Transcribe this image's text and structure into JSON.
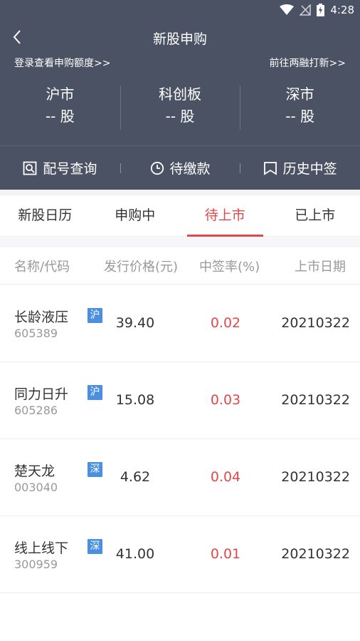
{
  "status": {
    "time": "4:28",
    "wifi_icon": "wifi-icon",
    "signal_icon": "no-signal-icon",
    "battery_icon": "battery-charging-icon"
  },
  "nav": {
    "back_icon": "back-arrow-icon",
    "title": "新股申购"
  },
  "links": {
    "left": "登录查看申购额度>>",
    "right": "前往两融打新>>"
  },
  "markets": [
    {
      "name": "沪市",
      "count": "-- 股"
    },
    {
      "name": "科创板",
      "count": "-- 股"
    },
    {
      "name": "深市",
      "count": "-- 股"
    }
  ],
  "actions": [
    {
      "label": "配号查询",
      "icon": "search-doc-icon"
    },
    {
      "label": "待缴款",
      "icon": "clock-icon"
    },
    {
      "label": "历史中签",
      "icon": "bookmark-icon"
    }
  ],
  "tabs": [
    {
      "label": "新股日历",
      "active": false
    },
    {
      "label": "申购中",
      "active": false
    },
    {
      "label": "待上市",
      "active": true
    },
    {
      "label": "已上市",
      "active": false
    }
  ],
  "table": {
    "headers": [
      "名称/代码",
      "发行价格(元)",
      "中签率(%)",
      "上市日期"
    ],
    "rows": [
      {
        "name": "长龄液压",
        "code": "605389",
        "market": "沪",
        "price": "39.40",
        "rate": "0.02",
        "date": "20210322"
      },
      {
        "name": "同力日升",
        "code": "605286",
        "market": "沪",
        "price": "15.08",
        "rate": "0.03",
        "date": "20210322"
      },
      {
        "name": "楚天龙",
        "code": "003040",
        "market": "深",
        "price": "4.62",
        "rate": "0.04",
        "date": "20210322"
      },
      {
        "name": "线上线下",
        "code": "300959",
        "market": "深",
        "price": "41.00",
        "rate": "0.01",
        "date": "20210322"
      }
    ]
  },
  "colors": {
    "header_bg": "#4b5263",
    "accent_red": "#e5474a",
    "badge_blue": "#4a8fe0"
  }
}
